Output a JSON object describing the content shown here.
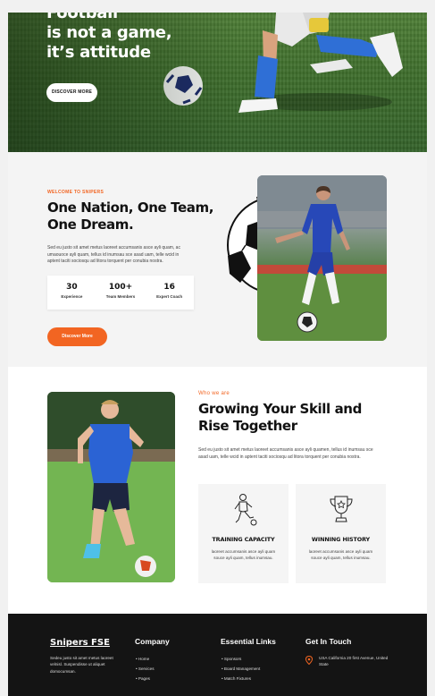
{
  "hero": {
    "title_line1": "Football",
    "title_line2": "is not a game,",
    "title_line3": "it’s attitude",
    "button_label": "DISCOVER MORE"
  },
  "about": {
    "eyebrow": "WELCOME TO SNIPERS",
    "title_line1": "One Nation, One Team,",
    "title_line2": "One Dream.",
    "body": "Sed eu justo sit amet metus laoreet accumsanis asce ayli quam, ac umaouoce ayli quam, tellus id inumsau sce asad uam, telle wcid in aptent taciti sociosqu ad litora torquent per conubia nostra.",
    "stats": [
      {
        "value": "30",
        "label": "Experience"
      },
      {
        "value": "100+",
        "label": "Team Members"
      },
      {
        "value": "16",
        "label": "Expert Coach"
      }
    ],
    "button_label": "Discover More"
  },
  "skills": {
    "eyebrow": "Who we are",
    "title_line1": "Growing Your Skill and",
    "title_line2": "Rise Together",
    "body": "Sed eu justo sit amet metus laoreet accumsanis asce ayli quamen, tellus id inumsau sce asad uam, telle wcid in aptent taciti sociosqu ad litora torquent per conubia nostra.",
    "cards": [
      {
        "icon": "player-kicking-icon",
        "title": "TRAINING CAPACITY",
        "text": "laoreet accumsanis asce ayli quam souce ayli quam, tellus inumsau."
      },
      {
        "icon": "trophy-icon",
        "title": "WINNING HISTORY",
        "text": "laoreet accumsanis asce ayli quam souce ayli quam, tellus inumsau."
      }
    ]
  },
  "footer": {
    "brand": "Snipers FSE",
    "description": "Sedeu justo sit amet metus laoreet velnisl. Suspendisse ut aliquet domocumsan.",
    "col_company": "Company",
    "company_links": [
      "Home",
      "Services",
      "Pages"
    ],
    "col_essential": "Essential Links",
    "essential_links": [
      "Sponsors",
      "Board Management",
      "Match Fixtures"
    ],
    "col_contact": "Get In Touch",
    "address": "USA California 20 first Avenue, United State"
  },
  "colors": {
    "accent": "#f26522",
    "footer_bg": "#141414",
    "section_bg": "#f4f4f4"
  }
}
